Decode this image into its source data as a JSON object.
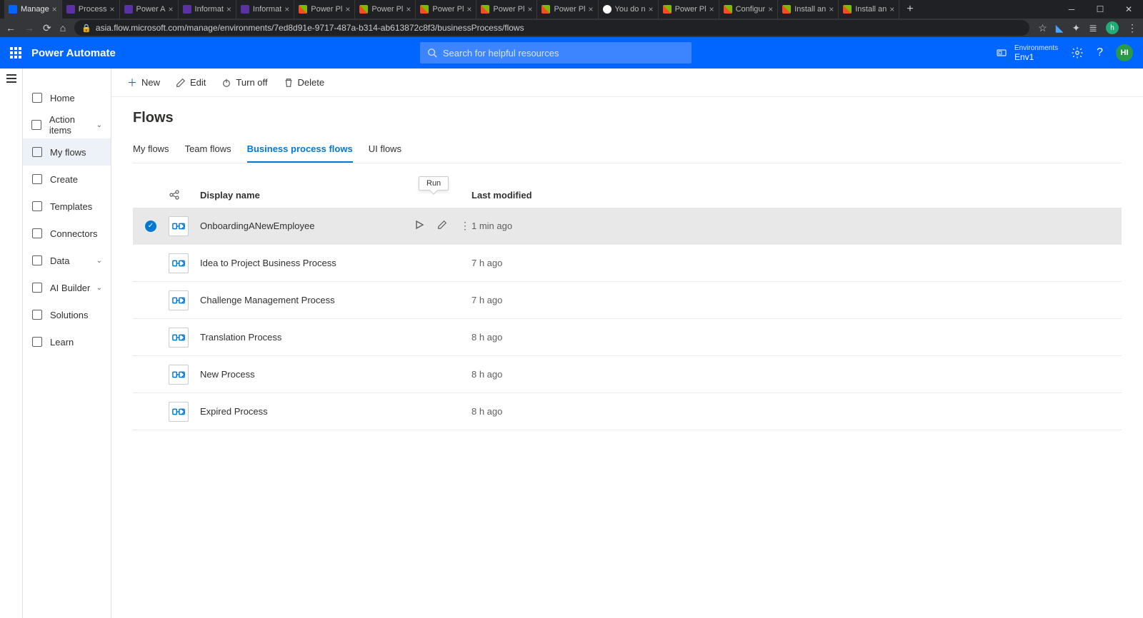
{
  "browser": {
    "tabs": [
      {
        "title": "Manage",
        "favicon": "pa",
        "active": true
      },
      {
        "title": "Process",
        "favicon": "purple"
      },
      {
        "title": "Power A",
        "favicon": "purple"
      },
      {
        "title": "Informat",
        "favicon": "purple"
      },
      {
        "title": "Informat",
        "favicon": "purple"
      },
      {
        "title": "Power Pl",
        "favicon": "ms"
      },
      {
        "title": "Power Pl",
        "favicon": "ms"
      },
      {
        "title": "Power Pl",
        "favicon": "ms"
      },
      {
        "title": "Power Pl",
        "favicon": "ms"
      },
      {
        "title": "Power Pl",
        "favicon": "ms"
      },
      {
        "title": "You do n",
        "favicon": "g"
      },
      {
        "title": "Power Pl",
        "favicon": "ms"
      },
      {
        "title": "Configur",
        "favicon": "ms"
      },
      {
        "title": "Install an",
        "favicon": "ms"
      },
      {
        "title": "Install an",
        "favicon": "ms"
      }
    ],
    "url": "asia.flow.microsoft.com/manage/environments/7ed8d91e-9717-487a-b314-ab613872c8f3/businessProcess/flows",
    "profile_initial": "h"
  },
  "header": {
    "app_title": "Power Automate",
    "search_placeholder": "Search for helpful resources",
    "env_label": "Environments",
    "env_name": "Env1",
    "avatar": "HI"
  },
  "sidebar": {
    "items": [
      {
        "label": "Home",
        "expandable": false
      },
      {
        "label": "Action items",
        "expandable": true
      },
      {
        "label": "My flows",
        "expandable": false,
        "active": true
      },
      {
        "label": "Create",
        "expandable": false
      },
      {
        "label": "Templates",
        "expandable": false
      },
      {
        "label": "Connectors",
        "expandable": false
      },
      {
        "label": "Data",
        "expandable": true
      },
      {
        "label": "AI Builder",
        "expandable": true
      },
      {
        "label": "Solutions",
        "expandable": false
      },
      {
        "label": "Learn",
        "expandable": false
      }
    ]
  },
  "commandbar": {
    "new": "New",
    "edit": "Edit",
    "turnoff": "Turn off",
    "delete": "Delete"
  },
  "page": {
    "title": "Flows"
  },
  "pivot": {
    "items": [
      {
        "label": "My flows"
      },
      {
        "label": "Team flows"
      },
      {
        "label": "Business process flows",
        "active": true
      },
      {
        "label": "UI flows"
      }
    ]
  },
  "list": {
    "tooltip": "Run",
    "headers": {
      "name": "Display name",
      "modified": "Last modified"
    },
    "rows": [
      {
        "name": "OnboardingANewEmployee",
        "modified": "1 min ago",
        "selected": true
      },
      {
        "name": "Idea to Project Business Process",
        "modified": "7 h ago"
      },
      {
        "name": "Challenge Management Process",
        "modified": "7 h ago"
      },
      {
        "name": "Translation Process",
        "modified": "8 h ago"
      },
      {
        "name": "New Process",
        "modified": "8 h ago"
      },
      {
        "name": "Expired Process",
        "modified": "8 h ago"
      }
    ]
  }
}
